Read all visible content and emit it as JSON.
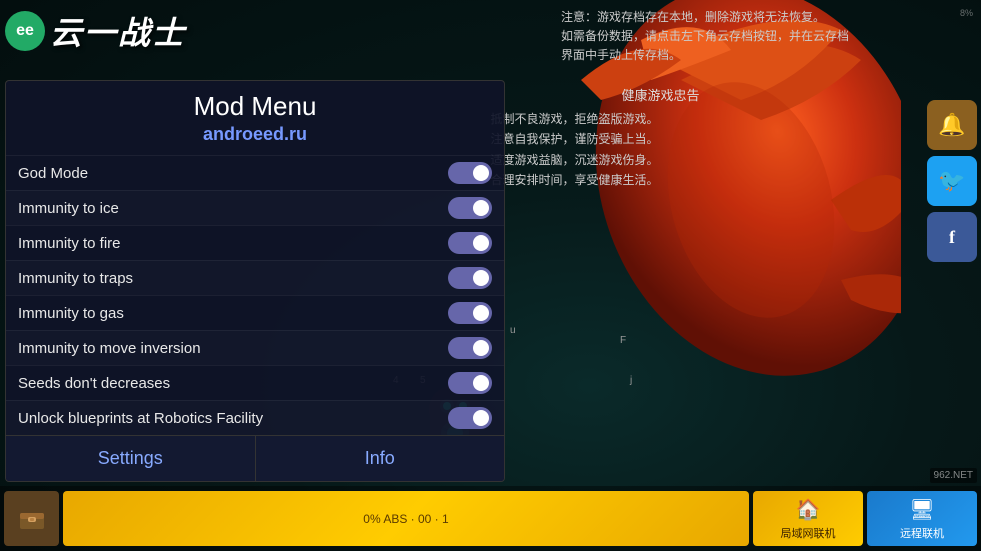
{
  "game": {
    "bg_color_center": "#0a2a2a",
    "bg_color_edge": "#030e0e"
  },
  "notice": {
    "top_right_text": "注意：游戏存档存在本地，删除游戏将无法恢复。\n如需备份数据，请点击左下角云存档按钮，并在云存档\n界面中手动上传存档。",
    "small_label": "8%",
    "health_title": "健康游戏忠告",
    "health_lines": [
      "抵制不良游戏，拒绝盗版游戏。",
      "注意自我保护，谨防受骗上当。",
      "适度游戏益脑，沉迷游戏伤身。",
      "合理安排时间，享受健康生活。"
    ]
  },
  "logo": {
    "circle_text": "ee",
    "main_text": "云一战士"
  },
  "mod_menu": {
    "title": "Mod Menu",
    "subtitle": "androeed.ru",
    "items": [
      {
        "label": "God Mode",
        "enabled": true
      },
      {
        "label": "Immunity to ice",
        "enabled": true
      },
      {
        "label": "Immunity to fire",
        "enabled": true
      },
      {
        "label": "Immunity to traps",
        "enabled": true
      },
      {
        "label": "Immunity to gas",
        "enabled": true
      },
      {
        "label": "Immunity to move inversion",
        "enabled": true
      },
      {
        "label": "Seeds don't decreases",
        "enabled": true
      },
      {
        "label": "Unlock blueprints at Robotics Facility",
        "enabled": true
      }
    ],
    "tabs": [
      {
        "label": "Settings"
      },
      {
        "label": "Info"
      }
    ]
  },
  "bottom_bar": {
    "yellow_bar_text": "0% ABS · 00 · 1",
    "local_btn_label": "局域网联机",
    "remote_btn_label": "远程联机"
  },
  "watermark": {
    "text": "962.NET"
  },
  "social": {
    "bell_icon": "🔔",
    "twitter_icon": "🐦",
    "facebook_icon": "f"
  }
}
